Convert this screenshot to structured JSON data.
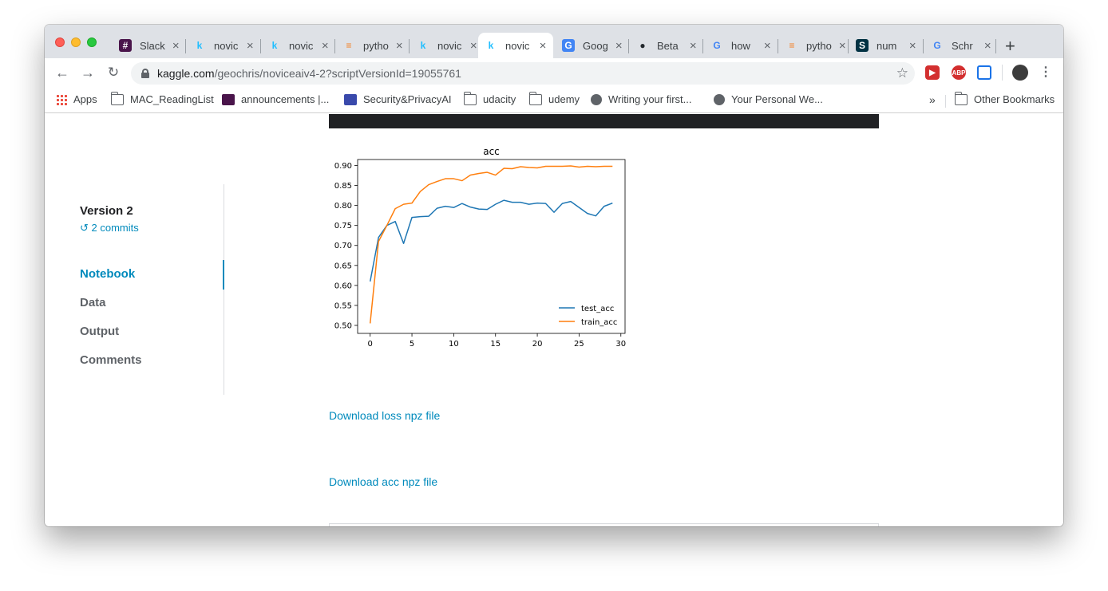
{
  "browser": {
    "tabs": [
      {
        "label": "Slack",
        "icon": "slack-icon"
      },
      {
        "label": "novic",
        "icon": "kaggle-icon"
      },
      {
        "label": "novic",
        "icon": "kaggle-icon"
      },
      {
        "label": "pytho",
        "icon": "stackoverflow-icon"
      },
      {
        "label": "novic",
        "icon": "kaggle-icon"
      },
      {
        "label": "novic",
        "icon": "kaggle-icon",
        "active": true
      },
      {
        "label": "Goog",
        "icon": "google-translate-icon"
      },
      {
        "label": "Beta",
        "icon": "github-icon"
      },
      {
        "label": "how",
        "icon": "google-icon"
      },
      {
        "label": "pytho",
        "icon": "stackoverflow-icon"
      },
      {
        "label": "num",
        "icon": "scipy-icon"
      },
      {
        "label": "Schr",
        "icon": "google-icon"
      }
    ],
    "url_host": "kaggle.com",
    "url_path": "/geochris/noviceaiv4-2?scriptVersionId=19055761",
    "bookmarks": [
      "Apps",
      "MAC_ReadingList",
      "announcements |...",
      "Security&PrivacyAI",
      "udacity",
      "udemy",
      "Writing your first...",
      "Your Personal We..."
    ],
    "other_bookmarks": "Other Bookmarks",
    "overflow": "»",
    "extension_labels": [
      "ABP"
    ]
  },
  "sidebar": {
    "version": "Version 2",
    "commits": "2 commits",
    "nav": [
      "Notebook",
      "Data",
      "Output",
      "Comments"
    ],
    "active": "Notebook"
  },
  "main": {
    "download_loss": "Download loss npz file",
    "download_acc": "Download acc npz file"
  },
  "chart_data": {
    "type": "line",
    "title": "acc",
    "xlabel": "",
    "ylabel": "",
    "xlim": [
      -1.5,
      30.5
    ],
    "ylim": [
      0.48,
      0.915
    ],
    "xticks": [
      0,
      5,
      10,
      15,
      20,
      25,
      30
    ],
    "yticks": [
      0.5,
      0.55,
      0.6,
      0.65,
      0.7,
      0.75,
      0.8,
      0.85,
      0.9
    ],
    "legend": "lower-right",
    "grid": false,
    "x": [
      0,
      1,
      2,
      3,
      4,
      5,
      6,
      7,
      8,
      9,
      10,
      11,
      12,
      13,
      14,
      15,
      16,
      17,
      18,
      19,
      20,
      21,
      22,
      23,
      24,
      25,
      26,
      27,
      28,
      29
    ],
    "series": [
      {
        "name": "test_acc",
        "color": "#1f77b4",
        "values": [
          0.61,
          0.72,
          0.75,
          0.76,
          0.705,
          0.77,
          0.772,
          0.773,
          0.793,
          0.798,
          0.795,
          0.805,
          0.796,
          0.791,
          0.79,
          0.803,
          0.813,
          0.808,
          0.808,
          0.803,
          0.806,
          0.805,
          0.783,
          0.805,
          0.81,
          0.795,
          0.78,
          0.774,
          0.798,
          0.806
        ]
      },
      {
        "name": "train_acc",
        "color": "#ff7f0e",
        "values": [
          0.505,
          0.71,
          0.75,
          0.792,
          0.803,
          0.806,
          0.835,
          0.852,
          0.86,
          0.867,
          0.867,
          0.862,
          0.876,
          0.88,
          0.883,
          0.876,
          0.893,
          0.892,
          0.897,
          0.895,
          0.894,
          0.898,
          0.898,
          0.898,
          0.899,
          0.896,
          0.898,
          0.897,
          0.898,
          0.898
        ]
      }
    ]
  }
}
